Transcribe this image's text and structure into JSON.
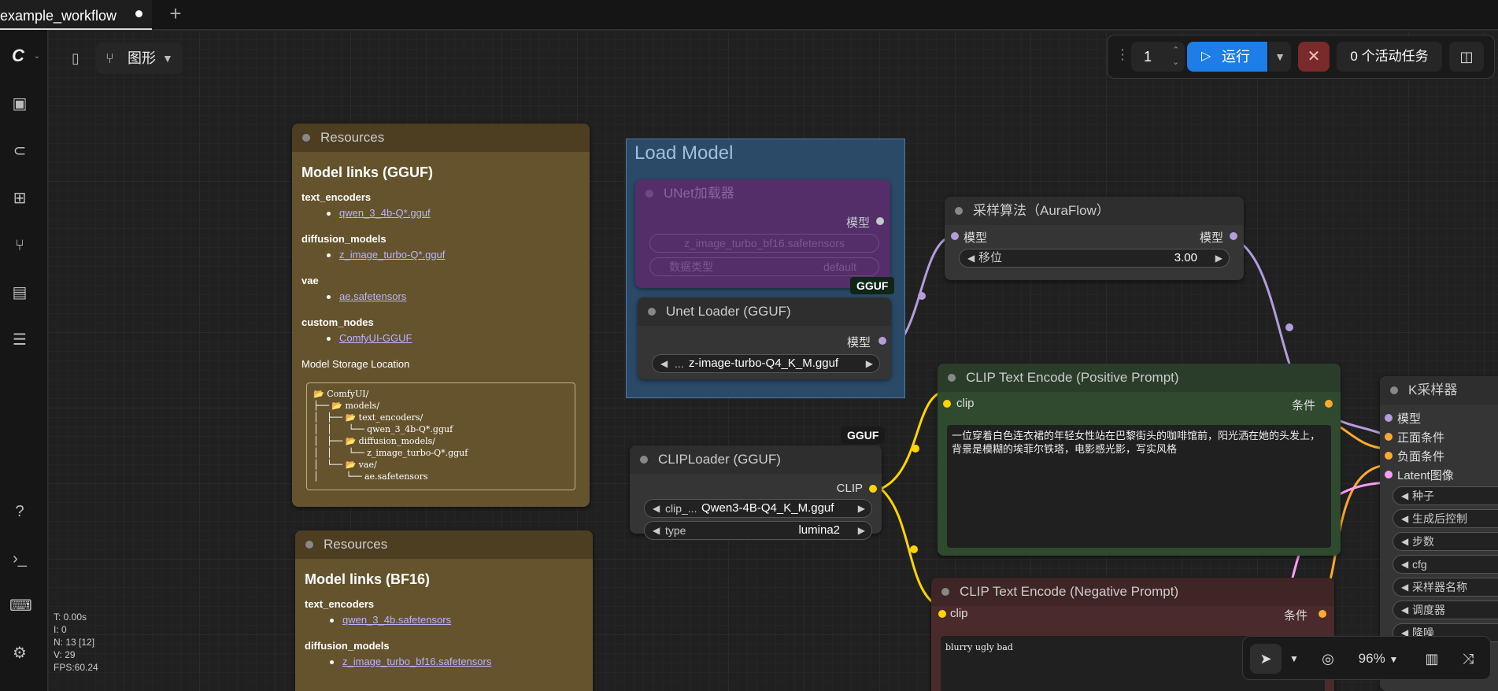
{
  "tab": {
    "title": "example_workflow",
    "new_tab": "+"
  },
  "toolbar": {
    "graph_label": "图形"
  },
  "run": {
    "count": "1",
    "run_label": "运行",
    "queue_label": "0 个活动任务"
  },
  "canvas_controls": {
    "zoom": "96%"
  },
  "stats": {
    "t": "T: 0.00s",
    "i": "I: 0",
    "n": "N: 13 [12]",
    "v": "V: 29",
    "fps": "FPS:60.24"
  },
  "resources1": {
    "title": "Resources",
    "heading": "Model links (GGUF)",
    "sections": [
      {
        "label": "text_encoders",
        "link": "qwen_3_4b-Q*.gguf"
      },
      {
        "label": "diffusion_models",
        "link": "z_image_turbo-Q*.gguf"
      },
      {
        "label": "vae",
        "link": "ae.safetensors"
      },
      {
        "label": "custom_nodes",
        "link": "ComfyUI-GGUF"
      }
    ],
    "storage_label": "Model Storage Location",
    "tree": "📂 ComfyUI/\n├── 📂 models/\n│   ├── 📂 text_encoders/\n│   │      └── qwen_3_4b-Q*.gguf\n│   ├── 📂 diffusion_models/\n│   │      └── z_image_turbo-Q*.gguf\n│   └── 📂 vae/\n│          └── ae.safetensors"
  },
  "resources2": {
    "title": "Resources",
    "heading": "Model links (BF16)",
    "sections": [
      {
        "label": "text_encoders",
        "link": "qwen_3_4b.safetensors"
      },
      {
        "label": "diffusion_models",
        "link": "z_image_turbo_bf16.safetensors"
      }
    ]
  },
  "group": {
    "title": "Load Model"
  },
  "unet_loader_bypassed": {
    "title": "UNet加载器",
    "output": "模型",
    "model_name": "z_image_turbo_bf16.safetensors",
    "dtype_label": "数据类型",
    "dtype_value": "default"
  },
  "unet_gguf": {
    "badge": "GGUF",
    "title": "Unet Loader (GGUF)",
    "output": "模型",
    "model": "z-image-turbo-Q4_K_M.gguf",
    "prefix": "..."
  },
  "clip_loader": {
    "badge": "GGUF",
    "title": "CLIPLoader (GGUF)",
    "output": "CLIP",
    "clip_label": "clip_...",
    "clip_value": "Qwen3-4B-Q4_K_M.gguf",
    "type_label": "type",
    "type_value": "lumina2"
  },
  "sampling": {
    "title": "采样算法（AuraFlow）",
    "input": "模型",
    "output": "模型",
    "shift_label": "移位",
    "shift_value": "3.00"
  },
  "pos_prompt": {
    "title": "CLIP Text Encode (Positive Prompt)",
    "input": "clip",
    "output": "条件",
    "text": "一位穿着白色连衣裙的年轻女性站在巴黎街头的咖啡馆前，阳光洒在她的头发上，背景是模糊的埃菲尔铁塔，电影感光影，写实风格"
  },
  "neg_prompt": {
    "title": "CLIP Text Encode (Negative Prompt)",
    "input": "clip",
    "output": "条件",
    "text": "blurry ugly bad"
  },
  "ksampler": {
    "title": "K采样器",
    "inputs": [
      "模型",
      "正面条件",
      "负面条件",
      "Latent图像"
    ],
    "widgets": [
      "种子",
      "生成后控制",
      "步数",
      "cfg",
      "采样器名称",
      "调度器",
      "降噪"
    ]
  },
  "colors": {
    "accent": "#1c7ee6",
    "group_blue": "#2b4a68",
    "positive": "#2f4a2f",
    "negative": "#4a2a2a",
    "resource": "#65532e",
    "model_link": "#b39ddb",
    "clip_link": "#ffd500",
    "cond_link": "#ffa931",
    "latent_link": "#ff9cf9"
  }
}
